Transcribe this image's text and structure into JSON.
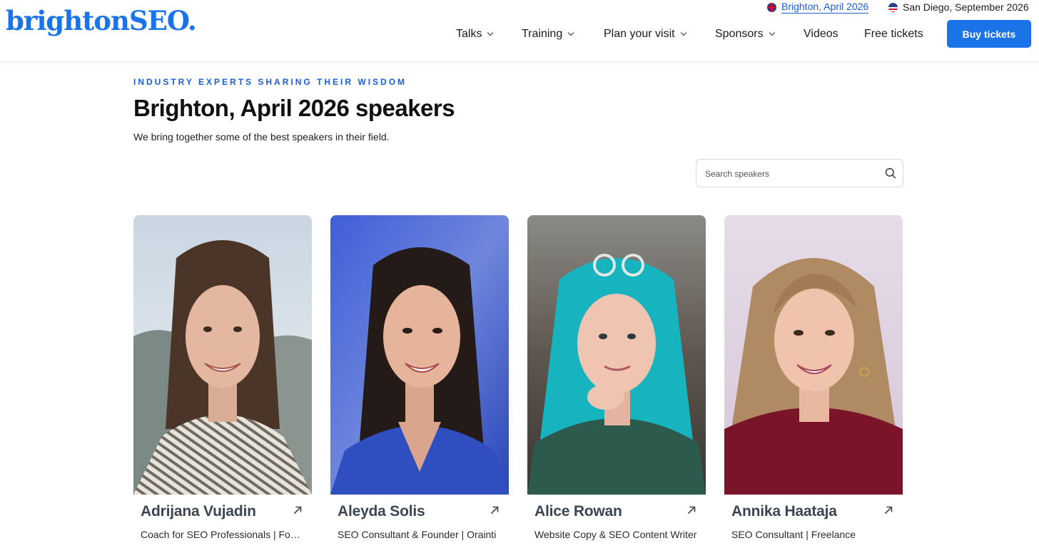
{
  "header": {
    "logo": "brightonSEO.",
    "events": [
      {
        "label": "Brighton, April 2026",
        "active": true,
        "flag": "uk-flag-icon"
      },
      {
        "label": "San Diego, September 2026",
        "active": false,
        "flag": "us-flag-icon"
      }
    ],
    "nav": [
      {
        "label": "Talks",
        "dropdown": true
      },
      {
        "label": "Training",
        "dropdown": true
      },
      {
        "label": "Plan your visit",
        "dropdown": true
      },
      {
        "label": "Sponsors",
        "dropdown": true
      },
      {
        "label": "Videos",
        "dropdown": false
      },
      {
        "label": "Free tickets",
        "dropdown": false
      }
    ],
    "cta": "Buy tickets"
  },
  "hero": {
    "eyebrow": "INDUSTRY EXPERTS SHARING THEIR WISDOM",
    "title": "Brighton, April 2026 speakers",
    "subtitle": "We bring together some of the best speakers in their field."
  },
  "search": {
    "placeholder": "Search speakers",
    "value": ""
  },
  "speakers": [
    {
      "name": "Adrijana Vujadin",
      "role": "Coach for SEO Professionals | Founder"
    },
    {
      "name": "Aleyda Solis",
      "role": "SEO Consultant & Founder | Orainti"
    },
    {
      "name": "Alice Rowan",
      "role": "Website Copy & SEO Content Writer"
    },
    {
      "name": "Annika Haataja",
      "role": "SEO Consultant | Freelance"
    }
  ],
  "colors": {
    "brand": "#1a73e8",
    "eyebrow": "#1a5fd6",
    "speaker_name": "#3b4652"
  }
}
